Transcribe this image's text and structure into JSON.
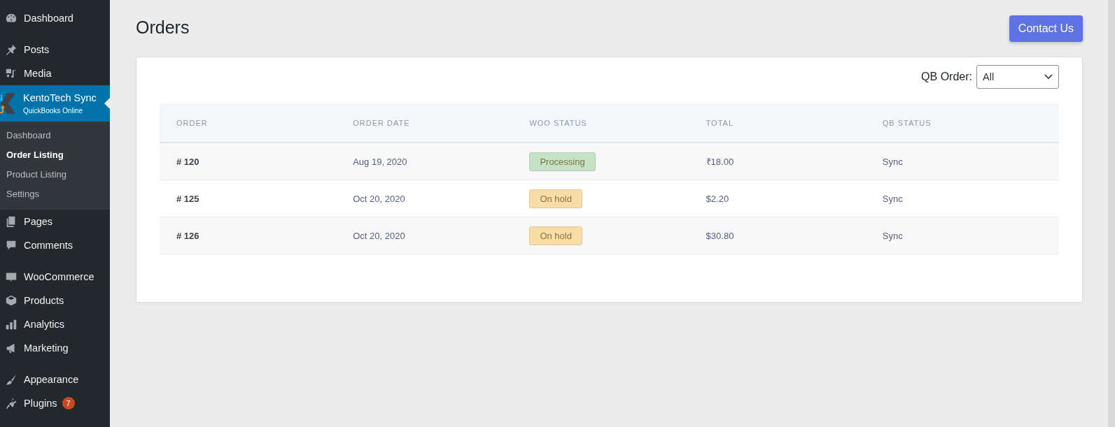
{
  "sidebar": {
    "groups": [
      [
        {
          "label": "Dashboard"
        }
      ],
      [
        {
          "label": "Posts"
        },
        {
          "label": "Media"
        },
        {
          "label": "KentoTech Sync",
          "sublabel": "QuickBooks Online",
          "current": true,
          "children": [
            {
              "label": "Dashboard",
              "selected": false
            },
            {
              "label": "Order Listing",
              "selected": true
            },
            {
              "label": "Product Listing",
              "selected": false
            },
            {
              "label": "Settings",
              "selected": false
            }
          ]
        },
        {
          "label": "Pages"
        },
        {
          "label": "Comments"
        }
      ],
      [
        {
          "label": "WooCommerce"
        },
        {
          "label": "Products"
        },
        {
          "label": "Analytics"
        },
        {
          "label": "Marketing"
        }
      ],
      [
        {
          "label": "Appearance"
        },
        {
          "label": "Plugins",
          "badge": "7"
        }
      ]
    ]
  },
  "page": {
    "title": "Orders",
    "contact_button": "Contact Us"
  },
  "filter": {
    "label": "QB Order:",
    "value": "All"
  },
  "table": {
    "columns": [
      "ORDER",
      "ORDER DATE",
      "WOO STATUS",
      "TOTAL",
      "QB STATUS"
    ],
    "rows": [
      {
        "order": "# 120",
        "date": "Aug 19, 2020",
        "status": "Processing",
        "color": "#c6e1c6",
        "total": "₹18.00",
        "qb_status": "Sync"
      },
      {
        "order": "# 125",
        "date": "Oct 20, 2020",
        "status": "On hold",
        "color": "#f8dda7",
        "total": "$2.20",
        "qb_status": "Sync"
      },
      {
        "order": "# 126",
        "date": "Oct 20, 2020",
        "status": "On hold",
        "color": "#f8dda7",
        "total": "$30.80",
        "qb_status": "Sync"
      }
    ]
  }
}
